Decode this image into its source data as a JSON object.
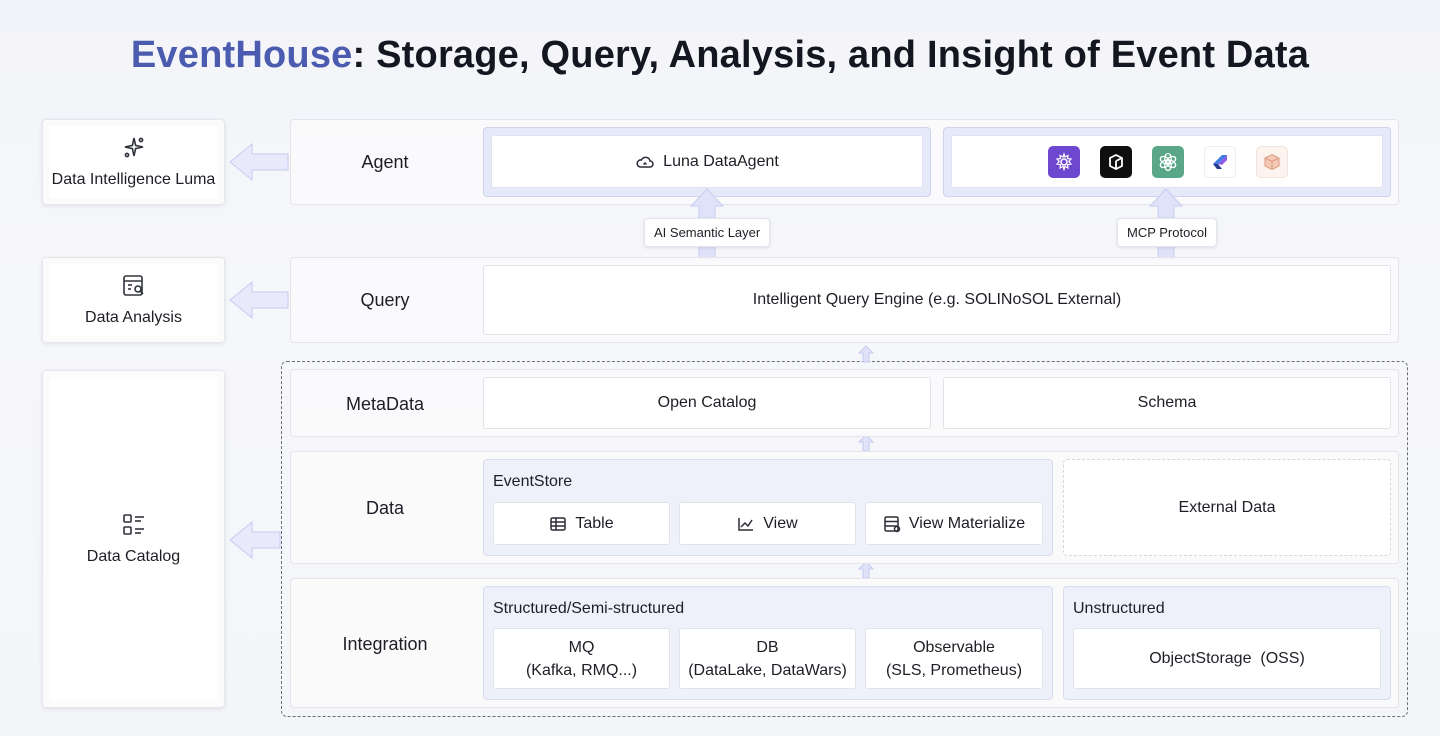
{
  "title": {
    "brand": "EventHouse",
    "rest": ": Storage, Query, Analysis, and Insight of Event Data"
  },
  "capabilities": {
    "luma": "Data Intelligence Luma",
    "analysis": "Data Analysis",
    "catalog": "Data Catalog"
  },
  "layers": {
    "agent": {
      "label": "Agent",
      "data_agent": "Luna DataAgent",
      "semantic_chip": "AI Semantic Layer",
      "mcp_chip": "MCP Protocol",
      "tools": [
        "gear-purple-icon",
        "cube-black-icon",
        "openai-green-icon",
        "kite-blue-icon",
        "package-peach-icon"
      ]
    },
    "query": {
      "label": "Query",
      "engine": "Intelligent Query Engine (e.g. SOLINoSOL External)"
    },
    "metadata": {
      "label": "MetaData",
      "open_catalog": "Open Catalog",
      "schema": "Schema"
    },
    "data": {
      "label": "Data",
      "eventstore_title": "EventStore",
      "table": "Table",
      "view": "View",
      "view_materialize": "View Materialize",
      "external": "External Data"
    },
    "integration": {
      "label": "Integration",
      "structured_title": "Structured/Semi-structured",
      "mq": {
        "line1": "MQ",
        "line2": "(Kafka, RMQ...)"
      },
      "db": {
        "line1": "DB",
        "line2": "(DataLake, DataWars)"
      },
      "observable": {
        "line1": "Observable",
        "line2": "(SLS, Prometheus)"
      },
      "unstructured_title": "Unstructured",
      "object_storage": "ObjectStorage  (OSS)"
    }
  },
  "colors": {
    "brand": "#4a5bb0",
    "arrow": "#c9cdf2",
    "panel": "#eef0fa"
  }
}
